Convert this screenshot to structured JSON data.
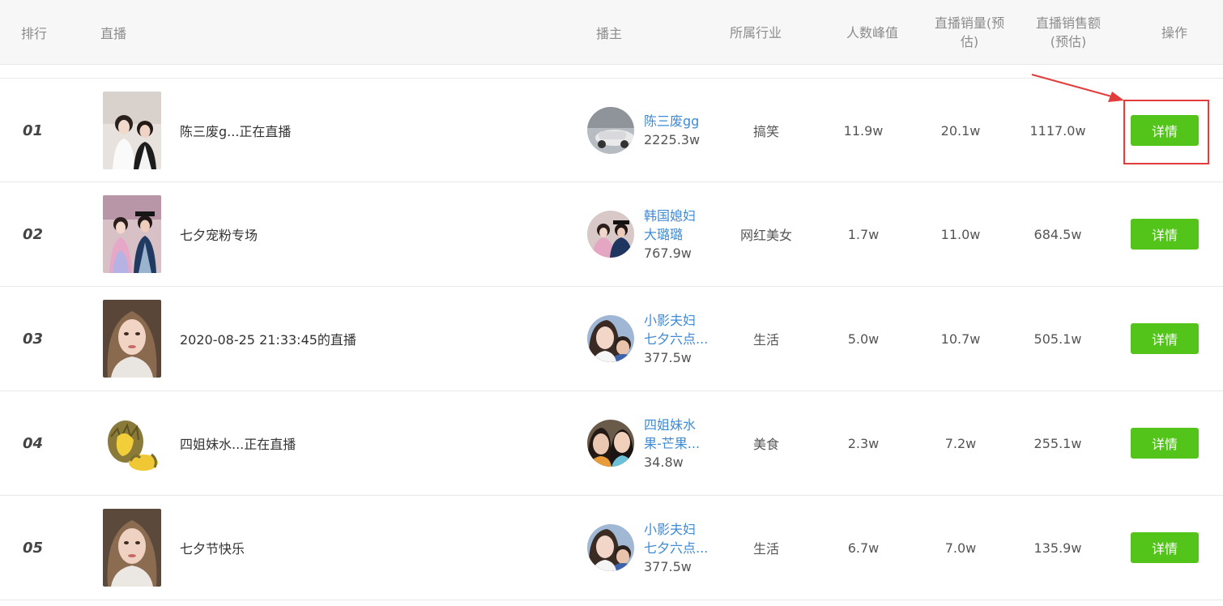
{
  "header": {
    "rank": "排行",
    "live": "直播",
    "anchor": "播主",
    "industry": "所属行业",
    "peak_viewers": "人数峰值",
    "sales_volume_line1": "直播销量(预",
    "sales_volume_line2": "估)",
    "sales_amount_line1": "直播销售额",
    "sales_amount_line2": "(预估)",
    "action": "操作"
  },
  "rows": [
    {
      "rank": "01",
      "title": "陈三废g...正在直播",
      "anchor_line1": "陈三废gg",
      "anchor_line2": "",
      "fans": "2225.3w",
      "industry": "搞笑",
      "peak": "11.9w",
      "volume": "20.1w",
      "amount": "1117.0w",
      "button": "详情"
    },
    {
      "rank": "02",
      "title": "七夕宠粉专场",
      "anchor_line1": "韩国媳妇",
      "anchor_line2": "大璐璐",
      "fans": "767.9w",
      "industry": "网红美女",
      "peak": "1.7w",
      "volume": "11.0w",
      "amount": "684.5w",
      "button": "详情"
    },
    {
      "rank": "03",
      "title": "2020-08-25 21:33:45的直播",
      "anchor_line1": "小影夫妇",
      "anchor_line2": "七夕六点...",
      "fans": "377.5w",
      "industry": "生活",
      "peak": "5.0w",
      "volume": "10.7w",
      "amount": "505.1w",
      "button": "详情"
    },
    {
      "rank": "04",
      "title": "四姐妹水...正在直播",
      "anchor_line1": "四姐妹水",
      "anchor_line2": "果-芒果...",
      "fans": "34.8w",
      "industry": "美食",
      "peak": "2.3w",
      "volume": "7.2w",
      "amount": "255.1w",
      "button": "详情"
    },
    {
      "rank": "05",
      "title": "七夕节快乐",
      "anchor_line1": "小影夫妇",
      "anchor_line2": "七夕六点...",
      "fans": "377.5w",
      "industry": "生活",
      "peak": "6.7w",
      "volume": "7.0w",
      "amount": "135.9w",
      "button": "详情"
    }
  ],
  "colors": {
    "accent_button": "#52c41a",
    "link": "#3f8ad4",
    "annotation": "#e23d3d"
  }
}
